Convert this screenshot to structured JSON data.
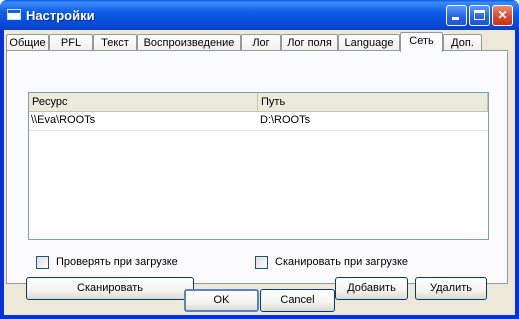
{
  "window": {
    "title": "Настройки"
  },
  "tabs": [
    "Общие",
    "PFL",
    "Текст",
    "Воспроизведение",
    "Лог",
    "Лог поля",
    "Language",
    "Сеть",
    "Доп."
  ],
  "active_tab": "Сеть",
  "table": {
    "columns": [
      "Ресурс",
      "Путь"
    ],
    "rows": [
      [
        "\\\\Eva\\ROOTs",
        "D:\\ROOTs"
      ]
    ]
  },
  "options": {
    "check_on_load": {
      "label": "Проверять при загрузке",
      "checked": false
    },
    "scan_on_load": {
      "label": "Сканировать при загрузке",
      "checked": false
    }
  },
  "buttons": {
    "scan": "Сканировать",
    "add": "Добавить",
    "delete": "Удалить",
    "ok": "OK",
    "cancel": "Cancel"
  },
  "colors": {
    "titlebar": "#0a58e8",
    "face": "#ece9d8",
    "close": "#d9472b"
  }
}
